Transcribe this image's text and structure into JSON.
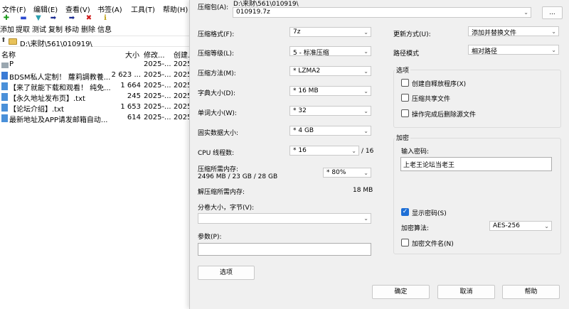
{
  "file_manager": {
    "menu": [
      "文件(F)",
      "编辑(E)",
      "查看(V)",
      "书签(A)",
      "工具(T)",
      "帮助(H)"
    ],
    "toolbar": [
      "添加",
      "提取",
      "测试",
      "复制",
      "移动",
      "删除",
      "信息"
    ],
    "toolbar_icons": [
      "plus-icon",
      "minus-icon",
      "check-icon",
      "copy-arrow-icon",
      "move-arrow-icon",
      "delete-x-icon",
      "info-icon"
    ],
    "toolbar_icon_colors": [
      "#1a9a1a",
      "#2a4ad0",
      "#2aa0b0",
      "#1a2a90",
      "#1a2a90",
      "#d01a1a",
      "#c0a010"
    ],
    "path": "D:\\来财\\561\\010919\\",
    "columns": [
      "名称",
      "大小",
      "修改...",
      "创建..."
    ],
    "files": [
      {
        "icon": "folder",
        "name": "P",
        "size": "",
        "modified": "2025-...",
        "created": "2025"
      },
      {
        "icon": "zip",
        "name": "BDSM私人定制！ 蘿莉調教養...",
        "size": "2 623 ...",
        "modified": "2025-...",
        "created": "2025"
      },
      {
        "icon": "file",
        "name": "【来了就能下载和观看！ 纯免...",
        "size": "1 664",
        "modified": "2025-...",
        "created": "2025"
      },
      {
        "icon": "file",
        "name": "【永久地址发布页】.txt",
        "size": "245",
        "modified": "2025-...",
        "created": "2025"
      },
      {
        "icon": "file",
        "name": "【论坛介绍】.txt",
        "size": "1 653",
        "modified": "2025-...",
        "created": "2025"
      },
      {
        "icon": "file",
        "name": "最新地址及APP请发邮箱自动...",
        "size": "614",
        "modified": "2025-...",
        "created": "2025"
      }
    ]
  },
  "dialog": {
    "archive_label": "压缩包(A):",
    "archive_dir": "D:\\来财\\561\\010919\\",
    "archive_name": "010919.7z",
    "browse_button": "...",
    "format_label": "压缩格式(F):",
    "format_value": "7z",
    "level_label": "压缩等级(L):",
    "level_value": "5 - 标准压缩",
    "method_label": "压缩方法(M):",
    "method_value": "*  LZMA2",
    "dict_label": "字典大小(D):",
    "dict_value": "*  16 MB",
    "word_label": "单词大小(W):",
    "word_value": "*  32",
    "solid_label": "固实数据大小:",
    "solid_value": "*  4 GB",
    "cpu_label": "CPU 线程数:",
    "cpu_value": "*  16",
    "cpu_total": "/ 16",
    "mem_label": "压缩所需内存:",
    "mem_detail": "2496 MB / 23 GB / 28 GB",
    "mem_percent": "* 80%",
    "decomp_label": "解压缩所需内存:",
    "decomp_value": "18 MB",
    "split_label": "分卷大小，字节(V):",
    "params_label": "参数(P):",
    "options_button": "选项",
    "update_label": "更新方式(U):",
    "update_value": "添加并替换文件",
    "pathmode_label": "路径模式",
    "pathmode_value": "相对路径",
    "options_group": "选项",
    "opt_sfx": "创建自释放程序(X)",
    "opt_shared": "压缩共享文件",
    "opt_delete": "操作完成后删除源文件",
    "encrypt_group": "加密",
    "password_label": "输入密码:",
    "password_value": "上老王论坛当老王",
    "show_password": "显示密码(S)",
    "enc_method_label": "加密算法:",
    "enc_method_value": "AES-256",
    "enc_names": "加密文件名(N)",
    "ok_button": "确定",
    "cancel_button": "取消",
    "help_button": "帮助"
  }
}
